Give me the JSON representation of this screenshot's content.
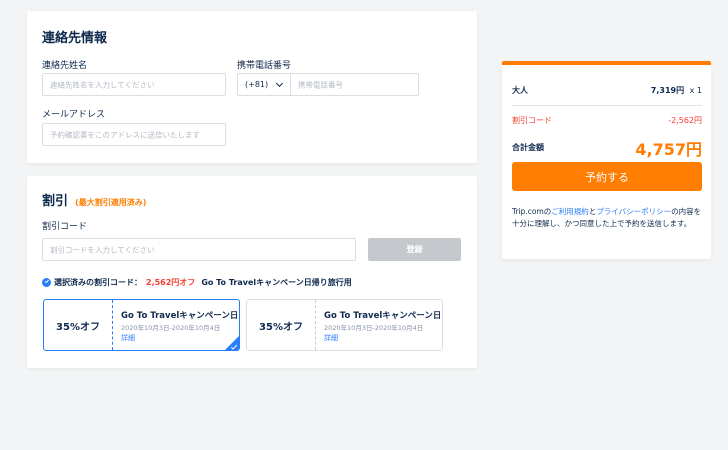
{
  "contact": {
    "title": "連絡先情報",
    "name_label": "連絡先姓名",
    "name_placeholder": "連絡先姓名を入力してください",
    "phone_label": "携帯電話番号",
    "country_code": "(+81)",
    "phone_placeholder": "携帯電話番号",
    "email_label": "メールアドレス",
    "email_placeholder": "予約確認書をこのアドレスに送信いたします"
  },
  "discount": {
    "title": "割引",
    "title_note": "(最大割引適用済み)",
    "code_label": "割引コード",
    "code_placeholder": "割引コードを入力してください",
    "register_button": "登録",
    "selected_prefix": "選択済みの割引コード：",
    "selected_amount": "2,562円オフ",
    "selected_name": "Go To Travelキャンペーン日帰り旅行用",
    "coupons": [
      {
        "percent": "35%オフ",
        "title": "Go To Travelキャンペーン日帰り旅行用",
        "dates": "2020年10月3日-2020年10月4日",
        "detail": "詳細"
      },
      {
        "percent": "35%オフ",
        "title": "Go To Travelキャンペーン日帰り旅行用",
        "dates": "2020年10月3日-2020年10月4日",
        "detail": "詳細"
      }
    ]
  },
  "summary": {
    "adult_label": "大人",
    "adult_price": "7,319円",
    "adult_qty": "x 1",
    "discount_label": "割引コード",
    "discount_value": "-2,562円",
    "total_label": "合計金額",
    "total_value": "4,757円",
    "book_button": "予約する",
    "terms_1": "Trip.comの",
    "terms_link1": "ご利用規約",
    "terms_2": "と",
    "terms_link2": "プライバシーポリシー",
    "terms_3": "の内容を十分に理解し、かつ同意した上で予約を送信します。"
  },
  "colors": {
    "accent": "#ff7d00",
    "link": "#287dfa",
    "text": "#0f294d",
    "discount_red": "#f63b2e"
  }
}
